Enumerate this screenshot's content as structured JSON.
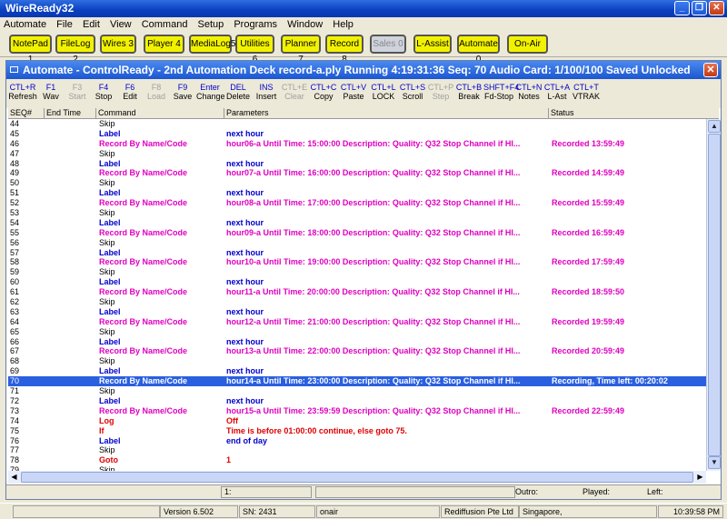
{
  "app": {
    "title": "WireReady32"
  },
  "menu": [
    "Automate",
    "File",
    "Edit",
    "View",
    "Command",
    "Setup",
    "Programs",
    "Window",
    "Help"
  ],
  "toolbar": {
    "buttons": [
      {
        "label": "NotePad",
        "num": "1"
      },
      {
        "label": "FileLog",
        "num": "2"
      },
      {
        "label": "Wires",
        "num": "3"
      },
      {
        "label": "Player",
        "num": "4"
      },
      {
        "label": "MediaLog",
        "num": "5"
      },
      {
        "label": "Utilities",
        "num": "6"
      },
      {
        "label": "Planner",
        "num": "7"
      },
      {
        "label": "Record",
        "num": "8"
      },
      {
        "label": "Sales",
        "num": "0"
      },
      {
        "label": "L-Assist",
        "num": ""
      },
      {
        "label": "Automate",
        "num": "0"
      },
      {
        "label": "On-Air",
        "num": ""
      }
    ]
  },
  "inner": {
    "title": "Automate - ControlReady - 2nd Automation Deck  record-a.ply  Running 4:19:31:36  Seq: 70 Audio Card: 1/100/100 Saved Unlocked",
    "keys": [
      {
        "key": "CTL+R",
        "label": "Refresh",
        "disabled": false
      },
      {
        "key": "F1",
        "label": "Wav",
        "disabled": false
      },
      {
        "key": "F3",
        "label": "Start",
        "disabled": true
      },
      {
        "key": "F4",
        "label": "Stop",
        "disabled": false
      },
      {
        "key": "F6",
        "label": "Edit",
        "disabled": false
      },
      {
        "key": "F8",
        "label": "Load",
        "disabled": true
      },
      {
        "key": "F9",
        "label": "Save",
        "disabled": false
      },
      {
        "key": "Enter",
        "label": "Change",
        "disabled": false
      },
      {
        "key": "DEL",
        "label": "Delete",
        "disabled": false
      },
      {
        "key": "INS",
        "label": "Insert",
        "disabled": false
      },
      {
        "key": "CTL+E",
        "label": "Clear",
        "disabled": true
      },
      {
        "key": "CTL+C",
        "label": "Copy",
        "disabled": false
      },
      {
        "key": "CTL+V",
        "label": "Paste",
        "disabled": false
      },
      {
        "key": "CTL+L",
        "label": "LOCK",
        "disabled": false
      },
      {
        "key": "CTL+S",
        "label": "Scroll",
        "disabled": false
      },
      {
        "key": "CTL+P",
        "label": "Step",
        "disabled": true
      },
      {
        "key": "CTL+B",
        "label": "Break",
        "disabled": false
      },
      {
        "key": "SHFT+F4",
        "label": "Fd-Stop",
        "disabled": false
      },
      {
        "key": "CTL+N",
        "label": "Notes",
        "disabled": false
      },
      {
        "key": "CTL+A",
        "label": "L-Ast",
        "disabled": false
      },
      {
        "key": "CTL+T",
        "label": "VTRAK",
        "disabled": false
      }
    ],
    "columns": [
      "SEQ#",
      "End Time",
      "Command",
      "Parameters",
      "Status"
    ],
    "rows": [
      {
        "seq": "44",
        "cmd": "Skip",
        "params": "",
        "status": "",
        "type": "skip"
      },
      {
        "seq": "45",
        "cmd": "Label",
        "params": "next hour",
        "status": "",
        "type": "label"
      },
      {
        "seq": "46",
        "cmd": "Record By Name/Code",
        "params": "hour06-a Until Time: 15:00:00 Description:  Quality: Q32 Stop Channel if HI...",
        "status": "Recorded 13:59:49",
        "type": "rec"
      },
      {
        "seq": "47",
        "cmd": "Skip",
        "params": "",
        "status": "",
        "type": "skip"
      },
      {
        "seq": "48",
        "cmd": "Label",
        "params": "next hour",
        "status": "",
        "type": "label"
      },
      {
        "seq": "49",
        "cmd": "Record By Name/Code",
        "params": "hour07-a Until Time: 16:00:00 Description:  Quality: Q32 Stop Channel if HI...",
        "status": "Recorded 14:59:49",
        "type": "rec"
      },
      {
        "seq": "50",
        "cmd": "Skip",
        "params": "",
        "status": "",
        "type": "skip"
      },
      {
        "seq": "51",
        "cmd": "Label",
        "params": "next hour",
        "status": "",
        "type": "label"
      },
      {
        "seq": "52",
        "cmd": "Record By Name/Code",
        "params": "hour08-a Until Time: 17:00:00 Description:  Quality: Q32 Stop Channel if HI...",
        "status": "Recorded 15:59:49",
        "type": "rec"
      },
      {
        "seq": "53",
        "cmd": "Skip",
        "params": "",
        "status": "",
        "type": "skip"
      },
      {
        "seq": "54",
        "cmd": "Label",
        "params": "next hour",
        "status": "",
        "type": "label"
      },
      {
        "seq": "55",
        "cmd": "Record By Name/Code",
        "params": "hour09-a Until Time: 18:00:00 Description:  Quality: Q32 Stop Channel if HI...",
        "status": "Recorded 16:59:49",
        "type": "rec"
      },
      {
        "seq": "56",
        "cmd": "Skip",
        "params": "",
        "status": "",
        "type": "skip"
      },
      {
        "seq": "57",
        "cmd": "Label",
        "params": "next hour",
        "status": "",
        "type": "label"
      },
      {
        "seq": "58",
        "cmd": "Record By Name/Code",
        "params": "hour10-a Until Time: 19:00:00 Description:  Quality: Q32 Stop Channel if HI...",
        "status": "Recorded 17:59:49",
        "type": "rec"
      },
      {
        "seq": "59",
        "cmd": "Skip",
        "params": "",
        "status": "",
        "type": "skip"
      },
      {
        "seq": "60",
        "cmd": "Label",
        "params": "next hour",
        "status": "",
        "type": "label"
      },
      {
        "seq": "61",
        "cmd": "Record By Name/Code",
        "params": "hour11-a Until Time: 20:00:00 Description:  Quality: Q32 Stop Channel if HI...",
        "status": "Recorded 18:59:50",
        "type": "rec"
      },
      {
        "seq": "62",
        "cmd": "Skip",
        "params": "",
        "status": "",
        "type": "skip"
      },
      {
        "seq": "63",
        "cmd": "Label",
        "params": "next hour",
        "status": "",
        "type": "label"
      },
      {
        "seq": "64",
        "cmd": "Record By Name/Code",
        "params": "hour12-a Until Time: 21:00:00 Description:  Quality: Q32 Stop Channel if HI...",
        "status": "Recorded 19:59:49",
        "type": "rec"
      },
      {
        "seq": "65",
        "cmd": "Skip",
        "params": "",
        "status": "",
        "type": "skip"
      },
      {
        "seq": "66",
        "cmd": "Label",
        "params": "next hour",
        "status": "",
        "type": "label"
      },
      {
        "seq": "67",
        "cmd": "Record By Name/Code",
        "params": "hour13-a Until Time: 22:00:00 Description:  Quality: Q32 Stop Channel if HI...",
        "status": "Recorded 20:59:49",
        "type": "rec"
      },
      {
        "seq": "68",
        "cmd": "Skip",
        "params": "",
        "status": "",
        "type": "skip"
      },
      {
        "seq": "69",
        "cmd": "Label",
        "params": "next hour",
        "status": "",
        "type": "label"
      },
      {
        "seq": "70",
        "cmd": "Record By Name/Code",
        "params": "hour14-a Until Time: 23:00:00 Description:  Quality: Q32 Stop Channel if HI...",
        "status": "Recording, Time left: 00:20:02",
        "type": "sel"
      },
      {
        "seq": "71",
        "cmd": "Skip",
        "params": "",
        "status": "",
        "type": "skip"
      },
      {
        "seq": "72",
        "cmd": "Label",
        "params": "next hour",
        "status": "",
        "type": "label"
      },
      {
        "seq": "73",
        "cmd": "Record By Name/Code",
        "params": "hour15-a Until Time: 23:59:59 Description:  Quality: Q32 Stop Channel if HI...",
        "status": "Recorded 22:59:49",
        "type": "rec"
      },
      {
        "seq": "74",
        "cmd": "Log",
        "params": "Off",
        "status": "",
        "type": "red"
      },
      {
        "seq": "75",
        "cmd": "If",
        "params": "Time is before 01:00:00 continue, else goto 75.",
        "status": "",
        "type": "red"
      },
      {
        "seq": "76",
        "cmd": "Label",
        "params": "end of day",
        "status": "",
        "type": "label"
      },
      {
        "seq": "77",
        "cmd": "Skip",
        "params": "",
        "status": "",
        "type": "skip"
      },
      {
        "seq": "78",
        "cmd": "Goto",
        "params": "1",
        "status": "",
        "type": "red"
      },
      {
        "seq": "79",
        "cmd": "Skip",
        "params": "",
        "status": "",
        "type": "skip"
      }
    ],
    "bottom": {
      "field": "1:",
      "outro": "Outro:",
      "played": "Played:",
      "left": "Left:"
    }
  },
  "status": {
    "version": "Version 6.502",
    "sn": "SN: 2431",
    "user": "onair",
    "company": "Rediffusion Pte Ltd",
    "location": "Singapore,",
    "time": "10:39:58 PM"
  },
  "colors": {
    "skip": "#000000",
    "label": "#0000cc",
    "rec": "#e000c0",
    "red": "#e00000",
    "selected": "#2a5fe0"
  }
}
